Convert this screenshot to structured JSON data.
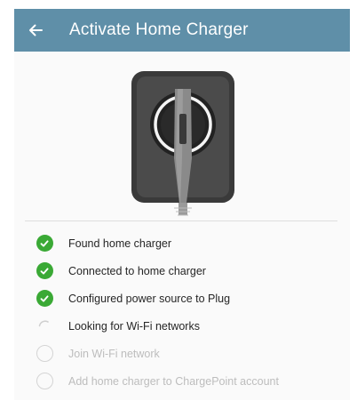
{
  "appbar": {
    "title": "Activate Home Charger",
    "back_icon": "arrow-left-icon",
    "color": "#5f8fa8"
  },
  "illustration": {
    "name": "home-charger-plug-illustration"
  },
  "steps": [
    {
      "label": "Found home charger",
      "status": "done"
    },
    {
      "label": "Connected to home charger",
      "status": "done"
    },
    {
      "label": "Configured power source to Plug",
      "status": "done"
    },
    {
      "label": "Looking for Wi-Fi networks",
      "status": "in-progress"
    },
    {
      "label": "Join Wi-Fi network",
      "status": "pending"
    },
    {
      "label": "Add home charger to ChargePoint account",
      "status": "pending"
    }
  ],
  "colors": {
    "done": "#3aa935",
    "pending": "#bdbdbd",
    "active_text": "#262626"
  }
}
